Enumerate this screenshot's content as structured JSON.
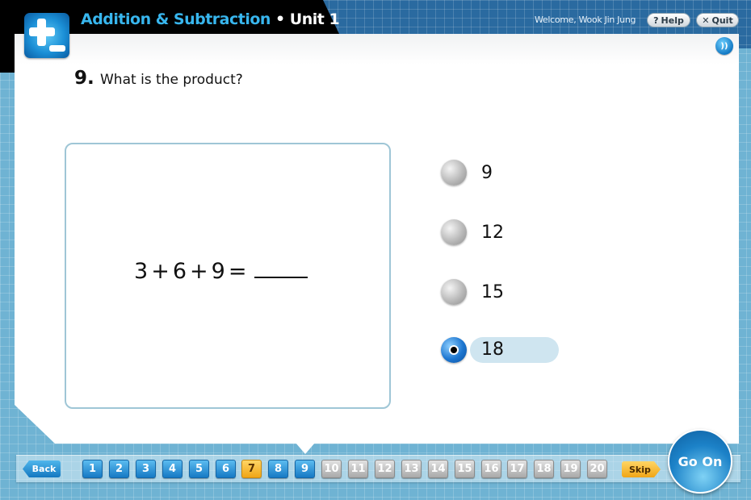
{
  "header": {
    "subject": "Addition & Subtraction",
    "separator": " • ",
    "unit": "Unit 1",
    "welcome": "Welcome, Wook Jin Jung",
    "help_icon": "question-icon",
    "help_glyph": "?",
    "help_label": "Help",
    "quit_icon": "x-icon",
    "quit_glyph": "✕",
    "quit_label": "Quit",
    "audio_icon": "speaker-icon",
    "audio_glyph": "))"
  },
  "question": {
    "number": "9.",
    "prompt": "What is the product?",
    "expression": [
      "3",
      "+",
      "6",
      "+",
      "9",
      "="
    ],
    "choices": [
      {
        "label": "9",
        "selected": false
      },
      {
        "label": "12",
        "selected": false
      },
      {
        "label": "15",
        "selected": false
      },
      {
        "label": "18",
        "selected": true
      }
    ]
  },
  "navigation": {
    "back_label": "Back",
    "skip_label": "Skip",
    "go_on_label": "Go On",
    "current_question": 9,
    "questions": [
      {
        "n": "1",
        "status": "answered"
      },
      {
        "n": "2",
        "status": "answered"
      },
      {
        "n": "3",
        "status": "answered"
      },
      {
        "n": "4",
        "status": "answered"
      },
      {
        "n": "5",
        "status": "answered"
      },
      {
        "n": "6",
        "status": "answered"
      },
      {
        "n": "7",
        "status": "skipped"
      },
      {
        "n": "8",
        "status": "answered"
      },
      {
        "n": "9",
        "status": "answered"
      },
      {
        "n": "10",
        "status": "pending"
      },
      {
        "n": "11",
        "status": "pending"
      },
      {
        "n": "12",
        "status": "pending"
      },
      {
        "n": "13",
        "status": "pending"
      },
      {
        "n": "14",
        "status": "pending"
      },
      {
        "n": "15",
        "status": "pending"
      },
      {
        "n": "16",
        "status": "pending"
      },
      {
        "n": "17",
        "status": "pending"
      },
      {
        "n": "18",
        "status": "pending"
      },
      {
        "n": "19",
        "status": "pending"
      },
      {
        "n": "20",
        "status": "pending"
      }
    ]
  },
  "colors": {
    "accent_blue": "#1c82c8",
    "title_cyan": "#38b6ee",
    "skipped_orange": "#f0a516",
    "selected_highlight": "#cfe5f0"
  }
}
